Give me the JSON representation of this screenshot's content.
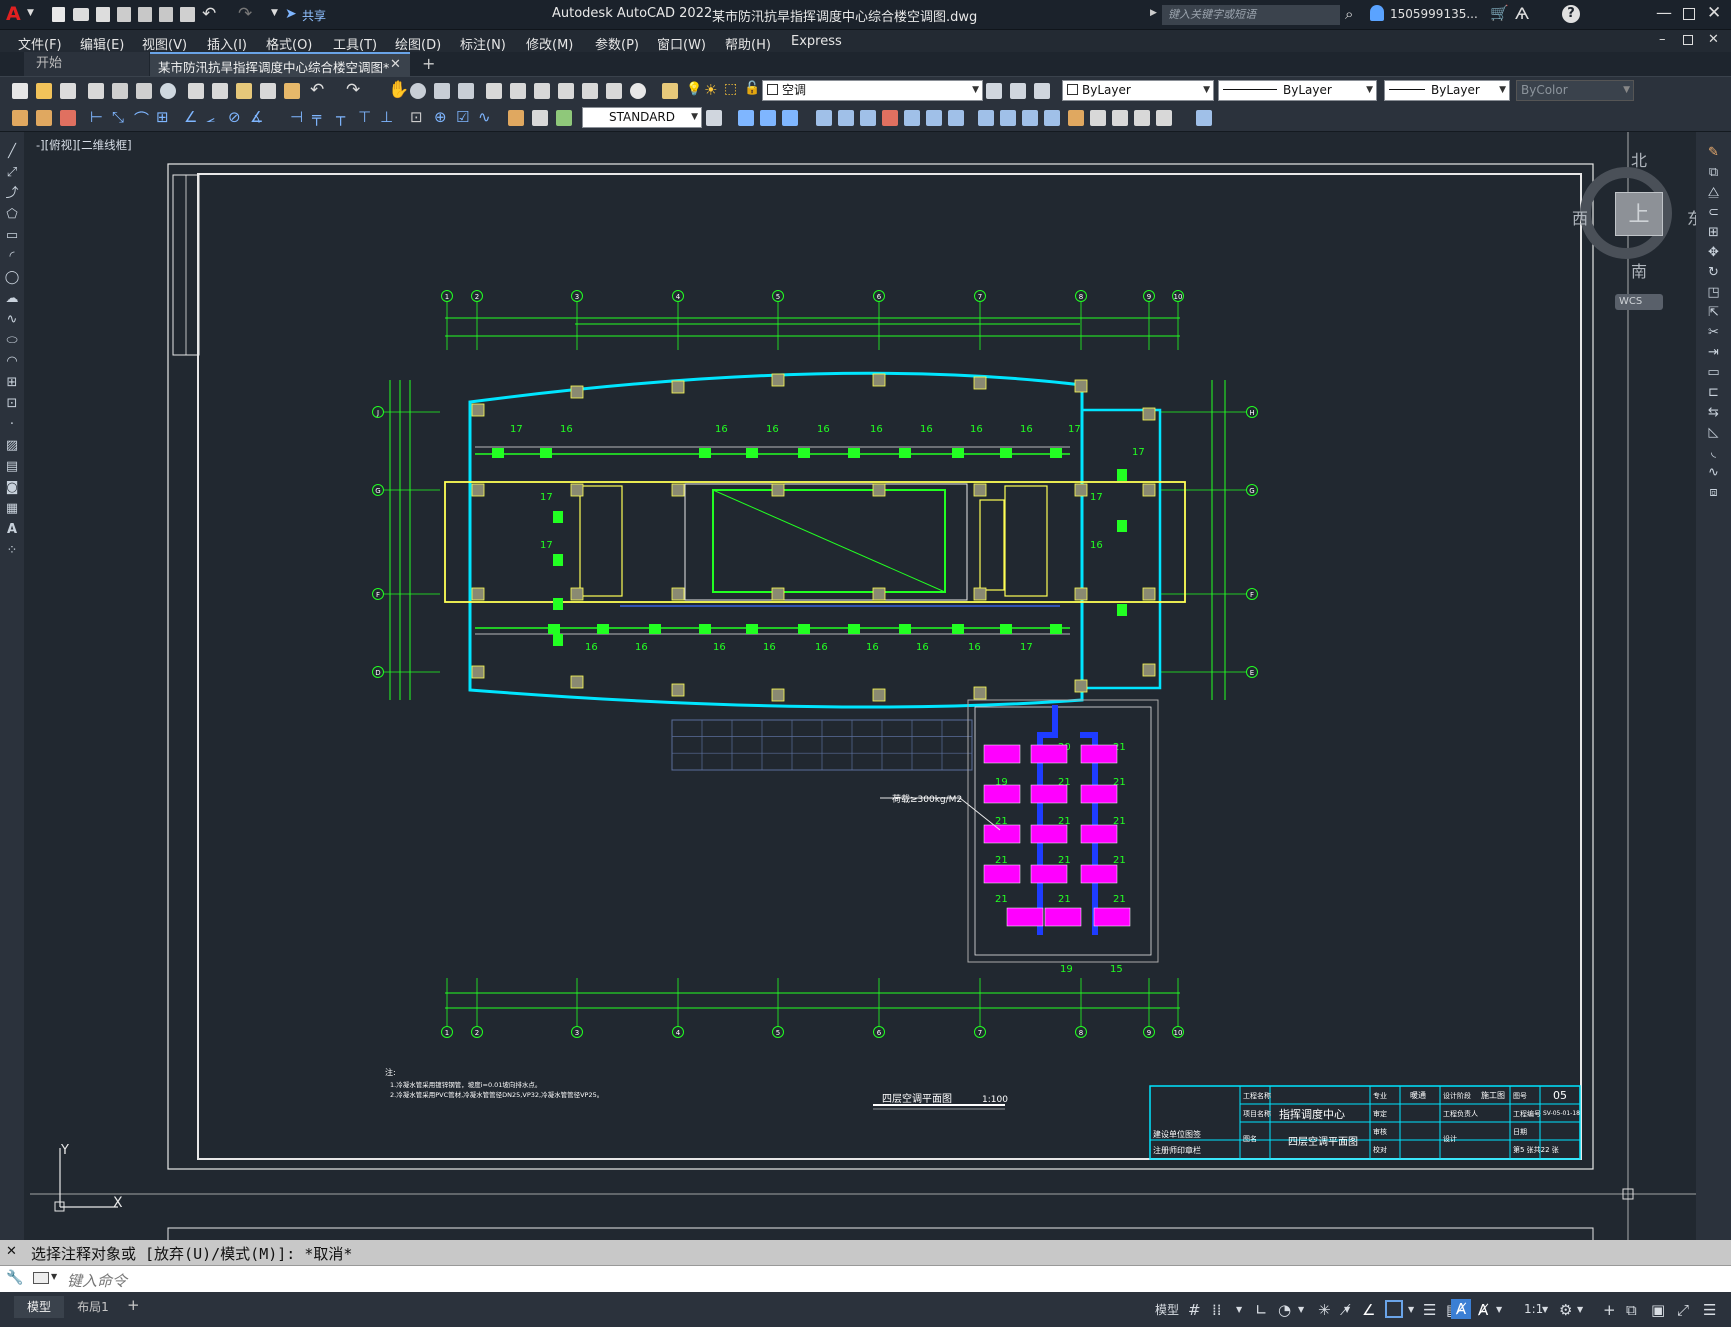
{
  "titlebar": {
    "app_title": "Autodesk AutoCAD 2022",
    "file_title": "某市防汛抗旱指挥调度中心综合楼空调图.dwg",
    "search_placeholder": "键入关键字或短语",
    "user": "1505999135...",
    "share_label": "共享"
  },
  "menu": [
    "文件(F)",
    "编辑(E)",
    "视图(V)",
    "插入(I)",
    "格式(O)",
    "工具(T)",
    "绘图(D)",
    "标注(N)",
    "修改(M)",
    "参数(P)",
    "窗口(W)",
    "帮助(H)",
    "Express"
  ],
  "tabs": {
    "start": "开始",
    "active": "某市防汛抗旱指挥调度中心综合楼空调图*"
  },
  "toolbar": {
    "layer": "空调",
    "color": "ByLayer",
    "linetype": "ByLayer",
    "lineweight": "ByLayer",
    "plotstyle": "ByColor",
    "textstyle": "STANDARD"
  },
  "viewport": {
    "label": "-][俯视][二维线框]",
    "viewcube": {
      "north": "北",
      "south": "南",
      "east": "东",
      "west": "西",
      "top": "上",
      "wcs": "WCS"
    }
  },
  "drawing": {
    "grid_top": [
      "1",
      "2",
      "3",
      "4",
      "5",
      "6",
      "7",
      "8",
      "9",
      "10"
    ],
    "grid_side_left": [
      "J",
      "G",
      "F",
      "D"
    ],
    "grid_side_right": [
      "H",
      "G",
      "F",
      "E"
    ],
    "unit_numbers": [
      "17",
      "16",
      "16",
      "16",
      "16",
      "16",
      "16",
      "16",
      "16",
      "17",
      "17",
      "17",
      "17",
      "17",
      "16",
      "16",
      "16",
      "16",
      "16",
      "16",
      "16",
      "16",
      "16",
      "17",
      "19",
      "21",
      "21",
      "21",
      "21",
      "21",
      "21",
      "21",
      "21",
      "21",
      "21",
      "21",
      "21",
      "20",
      "19",
      "15"
    ],
    "load_note": "荷载≥300kg/M2",
    "plan_title": "四层空调平面图",
    "plan_scale": "1:100",
    "notes_title": "注:",
    "notes": [
      "1.冷凝水管采用镀锌钢管，坡度i=0.01坡向排水点。",
      "2.冷凝水管采用PVC管材,冷凝水管管径DN25,VP32,冷凝水管管径VP25。"
    ],
    "titleblock": {
      "project": "指挥调度中心",
      "drawing_name": "四层空调平面图",
      "sheet_no": "05",
      "phase": "施工图",
      "discipline": "暖通",
      "code": "SV-05-01-18",
      "sheet_count": "第5 张共22 张",
      "labels": [
        "工程名称",
        "项目名称",
        "图名",
        "专业",
        "设计阶段",
        "图号",
        "审定",
        "审核",
        "校对",
        "设计",
        "工程负责人",
        "工程编号",
        "日期"
      ],
      "left_labels": [
        "建设单位图签",
        "注册师印章栏"
      ]
    }
  },
  "command": {
    "history": "选择注释对象或 [放弃(U)/模式(M)]: *取消*",
    "placeholder": "键入命令"
  },
  "layout_tabs": [
    "模型",
    "布局1"
  ],
  "status": {
    "model": "模型",
    "scale": "1:1"
  }
}
